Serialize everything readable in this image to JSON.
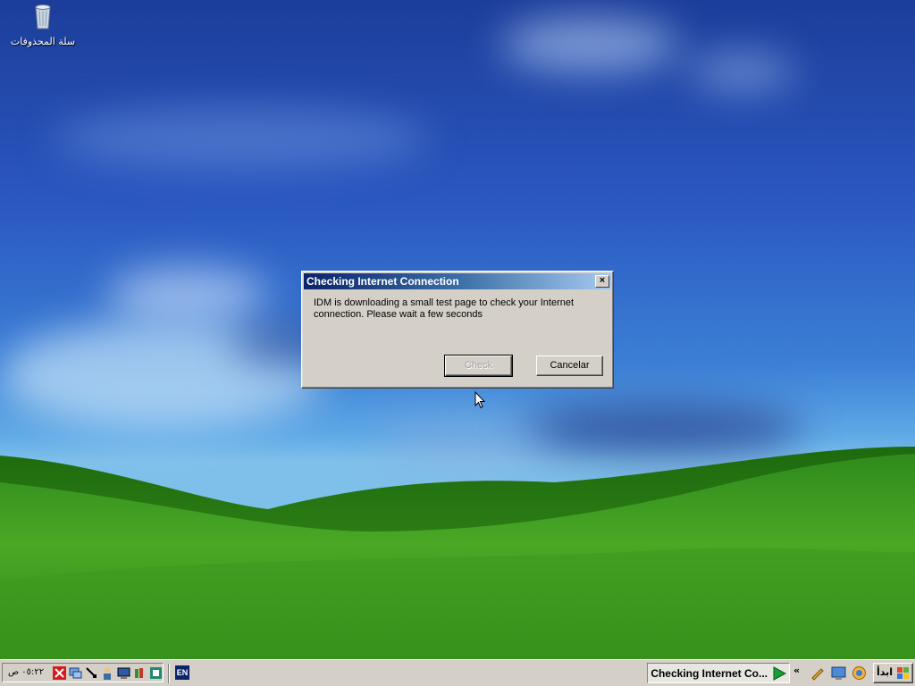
{
  "desktop": {
    "recycle_bin_label": "سلة المحذوفات"
  },
  "dialog": {
    "title": "Checking Internet Connection",
    "close_symbol": "×",
    "message_line1": "IDM is downloading a small test page to check your Internet",
    "message_line2": "connection. Please wait a few seconds",
    "check_label": "Check",
    "check_enabled": false,
    "cancel_label": "Cancelar"
  },
  "taskbar": {
    "clock": "٠٥:٢٢ ص",
    "language": "EN",
    "task_label": "Checking Internet Co...",
    "chevron": "«",
    "start_label": "ابدأ",
    "tray_icons": [
      "idm-icon",
      "network-icon",
      "pointer-icon",
      "user-icon",
      "display-icon",
      "books-icon",
      "shield-icon"
    ],
    "quick_launch_icons": [
      "tool-icon",
      "desktop-icon",
      "browser-icon"
    ]
  },
  "colors": {
    "dialog_face": "#d4d0c8",
    "title_gradient_start": "#0a246a",
    "title_gradient_end": "#a6caf0",
    "taskbar_face": "#d4d0c8"
  }
}
